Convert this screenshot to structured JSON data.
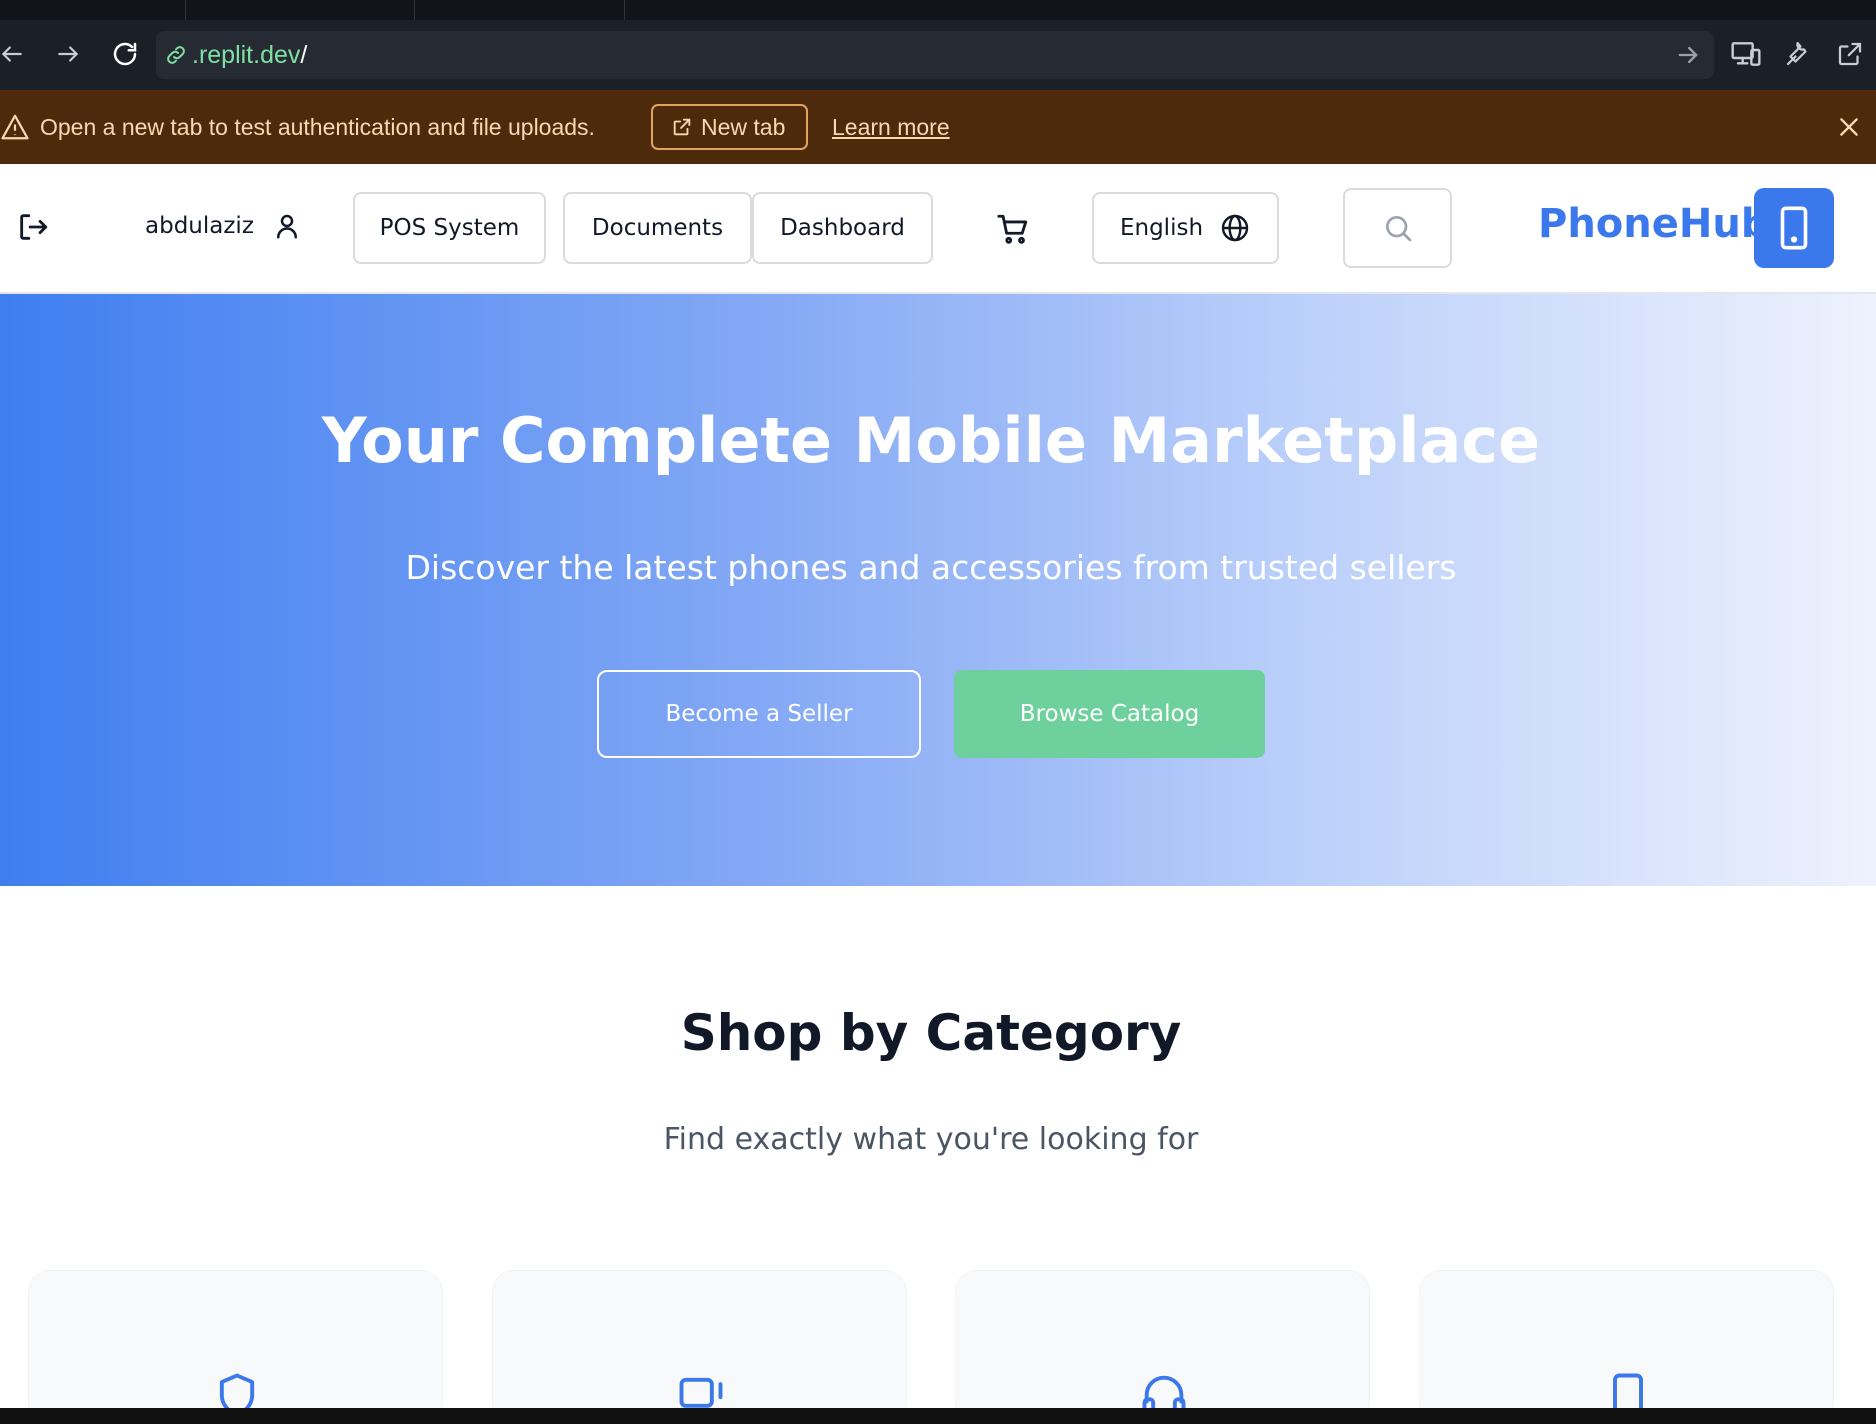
{
  "browser": {
    "url_host": ".replit.dev",
    "url_path": "/"
  },
  "banner": {
    "message": "Open a new tab to test authentication and file uploads.",
    "new_tab_label": "New tab",
    "learn_more_label": "Learn more"
  },
  "header": {
    "username": "abdulaziz",
    "nav": [
      "POS System",
      "Documents",
      "Dashboard"
    ],
    "language": "English",
    "brand": "PhoneHub"
  },
  "hero": {
    "title": "Your Complete Mobile Marketplace",
    "subtitle": "Discover the latest phones and accessories from trusted sellers",
    "seller_button": "Become a Seller",
    "browse_button": "Browse Catalog"
  },
  "categories": {
    "title": "Shop by Category",
    "subtitle": "Find exactly what you're looking for",
    "card_icons": [
      "shield-icon",
      "devices-icon",
      "headphones-icon",
      "smartphone-icon"
    ]
  },
  "colors": {
    "brand": "#3b78ec",
    "browse_button": "#6ed19d",
    "banner_bg": "#4e2a0c"
  }
}
